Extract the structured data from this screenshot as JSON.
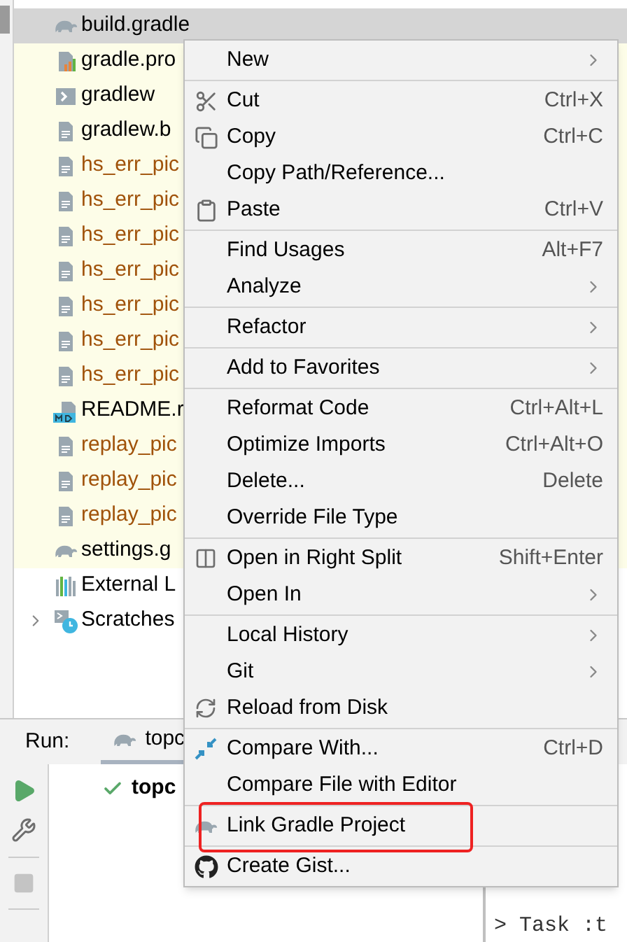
{
  "project_tree": [
    {
      "label": "build.gradle",
      "kind": "gradle",
      "color": "#000000",
      "selected": true
    },
    {
      "label": "gradle.pro",
      "kind": "properties",
      "color": "#000000",
      "selected": false
    },
    {
      "label": "gradlew",
      "kind": "shell",
      "color": "#000000",
      "selected": false
    },
    {
      "label": "gradlew.b",
      "kind": "text",
      "color": "#000000",
      "selected": false
    },
    {
      "label": "hs_err_pic",
      "kind": "text",
      "color": "#a0520a",
      "selected": false
    },
    {
      "label": "hs_err_pic",
      "kind": "text",
      "color": "#a0520a",
      "selected": false
    },
    {
      "label": "hs_err_pic",
      "kind": "text",
      "color": "#a0520a",
      "selected": false
    },
    {
      "label": "hs_err_pic",
      "kind": "text",
      "color": "#a0520a",
      "selected": false
    },
    {
      "label": "hs_err_pic",
      "kind": "text",
      "color": "#a0520a",
      "selected": false
    },
    {
      "label": "hs_err_pic",
      "kind": "text",
      "color": "#a0520a",
      "selected": false
    },
    {
      "label": "hs_err_pic",
      "kind": "text",
      "color": "#a0520a",
      "selected": false
    },
    {
      "label": "README.r",
      "kind": "markdown",
      "color": "#000000",
      "selected": false
    },
    {
      "label": "replay_pic",
      "kind": "text",
      "color": "#a0520a",
      "selected": false
    },
    {
      "label": "replay_pic",
      "kind": "text",
      "color": "#a0520a",
      "selected": false
    },
    {
      "label": "replay_pic",
      "kind": "text",
      "color": "#a0520a",
      "selected": false
    },
    {
      "label": "settings.g",
      "kind": "gradle",
      "color": "#000000",
      "selected": false
    },
    {
      "label": "External L",
      "kind": "library",
      "color": "#000000",
      "selected": false,
      "expandable": false
    },
    {
      "label": "Scratches",
      "kind": "scratches",
      "color": "#000000",
      "selected": false,
      "expandable": true
    }
  ],
  "run_panel": {
    "title": "Run:",
    "tab": "topc",
    "result": "topc",
    "console_line": "> Task :t"
  },
  "context_menu": [
    {
      "kind": "plain",
      "label": "New",
      "submenu": true
    },
    {
      "kind": "separator"
    },
    {
      "kind": "cut",
      "label": "Cut",
      "shortcut": "Ctrl+X"
    },
    {
      "kind": "copy",
      "label": "Copy",
      "shortcut": "Ctrl+C"
    },
    {
      "kind": "plain",
      "label": "Copy Path/Reference..."
    },
    {
      "kind": "paste",
      "label": "Paste",
      "shortcut": "Ctrl+V"
    },
    {
      "kind": "separator"
    },
    {
      "kind": "plain",
      "label": "Find Usages",
      "shortcut": "Alt+F7"
    },
    {
      "kind": "plain",
      "label": "Analyze",
      "submenu": true
    },
    {
      "kind": "separator"
    },
    {
      "kind": "plain",
      "label": "Refactor",
      "submenu": true
    },
    {
      "kind": "separator"
    },
    {
      "kind": "plain",
      "label": "Add to Favorites",
      "submenu": true
    },
    {
      "kind": "separator"
    },
    {
      "kind": "plain",
      "label": "Reformat Code",
      "shortcut": "Ctrl+Alt+L"
    },
    {
      "kind": "plain",
      "label": "Optimize Imports",
      "shortcut": "Ctrl+Alt+O"
    },
    {
      "kind": "plain",
      "label": "Delete...",
      "shortcut": "Delete"
    },
    {
      "kind": "plain",
      "label": "Override File Type"
    },
    {
      "kind": "separator"
    },
    {
      "kind": "split",
      "label": "Open in Right Split",
      "shortcut": "Shift+Enter"
    },
    {
      "kind": "plain",
      "label": "Open In",
      "submenu": true
    },
    {
      "kind": "separator"
    },
    {
      "kind": "plain",
      "label": "Local History",
      "submenu": true
    },
    {
      "kind": "plain",
      "label": "Git",
      "submenu": true
    },
    {
      "kind": "reload",
      "label": "Reload from Disk"
    },
    {
      "kind": "separator"
    },
    {
      "kind": "compare",
      "label": "Compare With...",
      "shortcut": "Ctrl+D"
    },
    {
      "kind": "plain",
      "label": "Compare File with Editor"
    },
    {
      "kind": "separator"
    },
    {
      "kind": "gradle",
      "label": "Link Gradle Project",
      "highlighted": true
    },
    {
      "kind": "separator"
    },
    {
      "kind": "github",
      "label": "Create Gist..."
    }
  ]
}
